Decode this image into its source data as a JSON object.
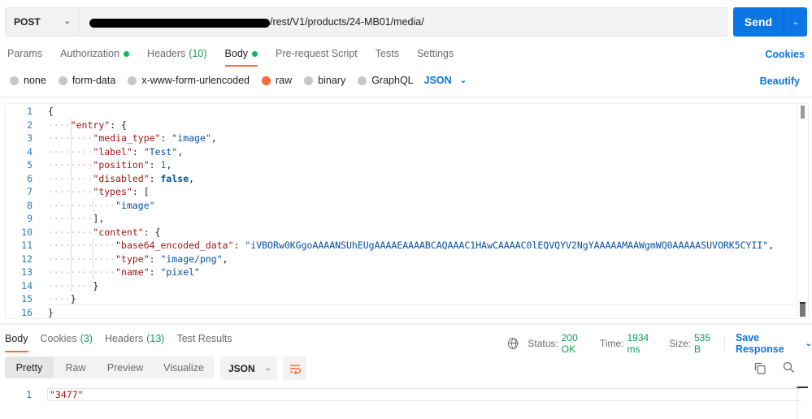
{
  "request": {
    "method": "POST",
    "url_visible_suffix": "/rest/V1/products/24-MB01/media/",
    "url_redacted": true,
    "send_label": "Send"
  },
  "request_tabs": [
    {
      "label": "Params"
    },
    {
      "label": "Authorization",
      "dot": true
    },
    {
      "label": "Headers",
      "count": "(10)"
    },
    {
      "label": "Body",
      "dot": true,
      "active": true
    },
    {
      "label": "Pre-request Script"
    },
    {
      "label": "Tests"
    },
    {
      "label": "Settings"
    }
  ],
  "cookies_label": "Cookies",
  "body_types": [
    {
      "label": "none"
    },
    {
      "label": "form-data"
    },
    {
      "label": "x-www-form-urlencoded"
    },
    {
      "label": "raw",
      "selected": true
    },
    {
      "label": "binary"
    },
    {
      "label": "GraphQL"
    }
  ],
  "body_format": "JSON",
  "beautify_label": "Beautify",
  "editor_lines": [
    {
      "n": "1",
      "indent": 0,
      "tokens": [
        [
          "p",
          "{"
        ]
      ]
    },
    {
      "n": "2",
      "indent": 1,
      "tokens": [
        [
          "k",
          "\"entry\""
        ],
        [
          "p",
          ": {"
        ]
      ]
    },
    {
      "n": "3",
      "indent": 2,
      "tokens": [
        [
          "k",
          "\"media_type\""
        ],
        [
          "p",
          ": "
        ],
        [
          "s",
          "\"image\""
        ],
        [
          "p",
          ","
        ]
      ]
    },
    {
      "n": "4",
      "indent": 2,
      "tokens": [
        [
          "k",
          "\"label\""
        ],
        [
          "p",
          ": "
        ],
        [
          "s",
          "\"Test\""
        ],
        [
          "p",
          ","
        ]
      ]
    },
    {
      "n": "5",
      "indent": 2,
      "tokens": [
        [
          "k",
          "\"position\""
        ],
        [
          "p",
          ": "
        ],
        [
          "n",
          "1"
        ],
        [
          "p",
          ","
        ]
      ]
    },
    {
      "n": "6",
      "indent": 2,
      "tokens": [
        [
          "k",
          "\"disabled\""
        ],
        [
          "p",
          ": "
        ],
        [
          "b",
          "false"
        ],
        [
          "p",
          ","
        ]
      ]
    },
    {
      "n": "7",
      "indent": 2,
      "tokens": [
        [
          "k",
          "\"types\""
        ],
        [
          "p",
          ": ["
        ]
      ]
    },
    {
      "n": "8",
      "indent": 3,
      "tokens": [
        [
          "s",
          "\"image\""
        ]
      ]
    },
    {
      "n": "9",
      "indent": 2,
      "tokens": [
        [
          "p",
          "],"
        ]
      ]
    },
    {
      "n": "10",
      "indent": 2,
      "tokens": [
        [
          "k",
          "\"content\""
        ],
        [
          "p",
          ": {"
        ]
      ]
    },
    {
      "n": "11",
      "indent": 3,
      "tokens": [
        [
          "k",
          "\"base64_encoded_data\""
        ],
        [
          "p",
          ": "
        ],
        [
          "s",
          "\"iVBORw0KGgoAAAANSUhEUgAAAAEAAAABCAQAAAC1HAwCAAAAC0lEQVQYV2NgYAAAAAMAAWgmWQ0AAAAASUVORK5CYII\""
        ],
        [
          "p",
          ","
        ]
      ]
    },
    {
      "n": "12",
      "indent": 3,
      "tokens": [
        [
          "k",
          "\"type\""
        ],
        [
          "p",
          ": "
        ],
        [
          "s",
          "\"image/png\""
        ],
        [
          "p",
          ","
        ]
      ]
    },
    {
      "n": "13",
      "indent": 3,
      "tokens": [
        [
          "k",
          "\"name\""
        ],
        [
          "p",
          ": "
        ],
        [
          "s",
          "\"pixel\""
        ]
      ]
    },
    {
      "n": "14",
      "indent": 2,
      "tokens": [
        [
          "p",
          "}"
        ]
      ]
    },
    {
      "n": "15",
      "indent": 1,
      "tokens": [
        [
          "p",
          "}"
        ]
      ]
    },
    {
      "n": "16",
      "indent": 0,
      "tokens": [
        [
          "p",
          "}"
        ]
      ]
    }
  ],
  "response_tabs": [
    {
      "label": "Body",
      "active": true
    },
    {
      "label": "Cookies",
      "count": "(3)"
    },
    {
      "label": "Headers",
      "count": "(13)"
    },
    {
      "label": "Test Results"
    }
  ],
  "response_status": {
    "status_label": "Status:",
    "status_value": "200 OK",
    "time_label": "Time:",
    "time_value": "1934 ms",
    "size_label": "Size:",
    "size_value": "535 B",
    "save_label": "Save Response"
  },
  "response_views": [
    "Pretty",
    "Raw",
    "Preview",
    "Visualize"
  ],
  "response_format": "JSON",
  "response_body": {
    "line": "1",
    "text": "\"3477\""
  },
  "icons": {
    "method_chevron": "chevron-down-icon",
    "send_chevron": "chevron-down-icon",
    "globe": "globe-icon",
    "wrap": "wrap-lines-icon",
    "copy": "copy-icon",
    "search": "search-icon"
  }
}
